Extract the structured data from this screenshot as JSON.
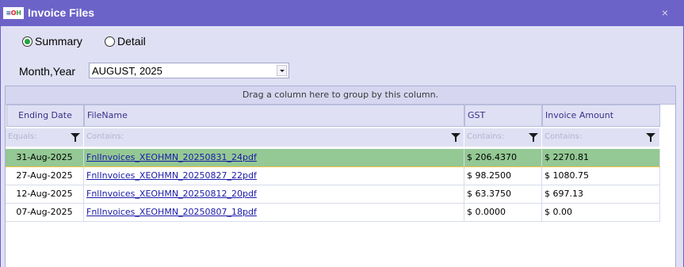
{
  "window": {
    "title": "Invoice Files",
    "close_label": "×"
  },
  "view_options": [
    {
      "label": "Summary",
      "checked": true
    },
    {
      "label": "Detail",
      "checked": false
    }
  ],
  "month": {
    "label": "Month,Year",
    "value": "AUGUST, 2025"
  },
  "grid": {
    "group_prompt": "Drag a column here to group by this column.",
    "columns": [
      {
        "label": "Ending Date",
        "filter": "Equals:"
      },
      {
        "label": "FileName",
        "filter": "Contains:"
      },
      {
        "label": "GST",
        "filter": "Contains:"
      },
      {
        "label": "Invoice Amount",
        "filter": "Contains:"
      }
    ],
    "rows": [
      {
        "date": "31-Aug-2025",
        "file": "FnlInvoices_XEOHMN_20250831_24pdf",
        "gst": "$ 206.4370",
        "amount": "$ 2270.81"
      },
      {
        "date": "27-Aug-2025",
        "file": "FnlInvoices_XEOHMN_20250827_22pdf",
        "gst": "$ 98.2500",
        "amount": "$ 1080.75"
      },
      {
        "date": "12-Aug-2025",
        "file": "FnlInvoices_XEOHMN_20250812_20pdf",
        "gst": "$ 63.3750",
        "amount": "$ 697.13"
      },
      {
        "date": "07-Aug-2025",
        "file": "FnlInvoices_XEOHMN_20250807_18pdf",
        "gst": "$ 0.0000",
        "amount": "$ 0.00"
      }
    ]
  },
  "colors": {
    "titlebar": "#6c63c8",
    "selected_row": "#94c894",
    "link": "#1a1aa8",
    "radio_checked": "#22a43a"
  }
}
